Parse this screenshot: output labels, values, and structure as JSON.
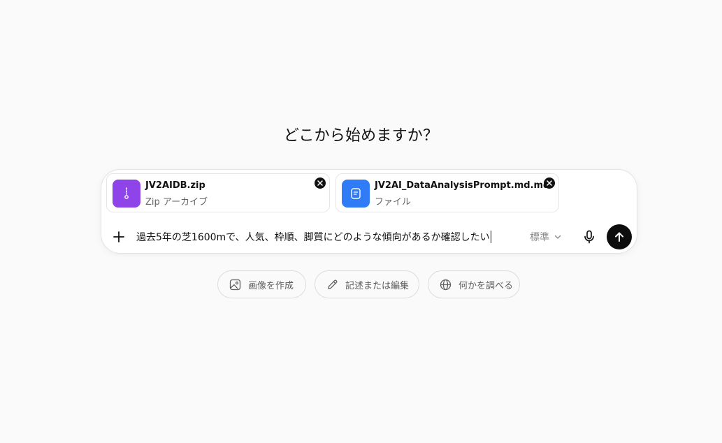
{
  "heading": "どこから始めますか？",
  "composer": {
    "attachments": [
      {
        "name": "JV2AIDB.zip",
        "type": "Zip アーカイブ",
        "icon": "zip-file-icon",
        "color": "#8e44e8"
      },
      {
        "name": "JV2AI_DataAnalysisPrompt.md.md",
        "type": "ファイル",
        "icon": "document-icon",
        "color": "#2f7cf6"
      }
    ],
    "prompt_text": "過去5年の芝1600mで、人気、枠順、脚質にどのような傾向があるか確認したい",
    "model_label": "標準",
    "send_color": "#0d0d0d"
  },
  "suggestions": [
    {
      "label": "画像を作成",
      "icon": "image-icon"
    },
    {
      "label": "記述または編集",
      "icon": "pencil-icon"
    },
    {
      "label": "何かを調べる",
      "icon": "globe-icon"
    }
  ]
}
